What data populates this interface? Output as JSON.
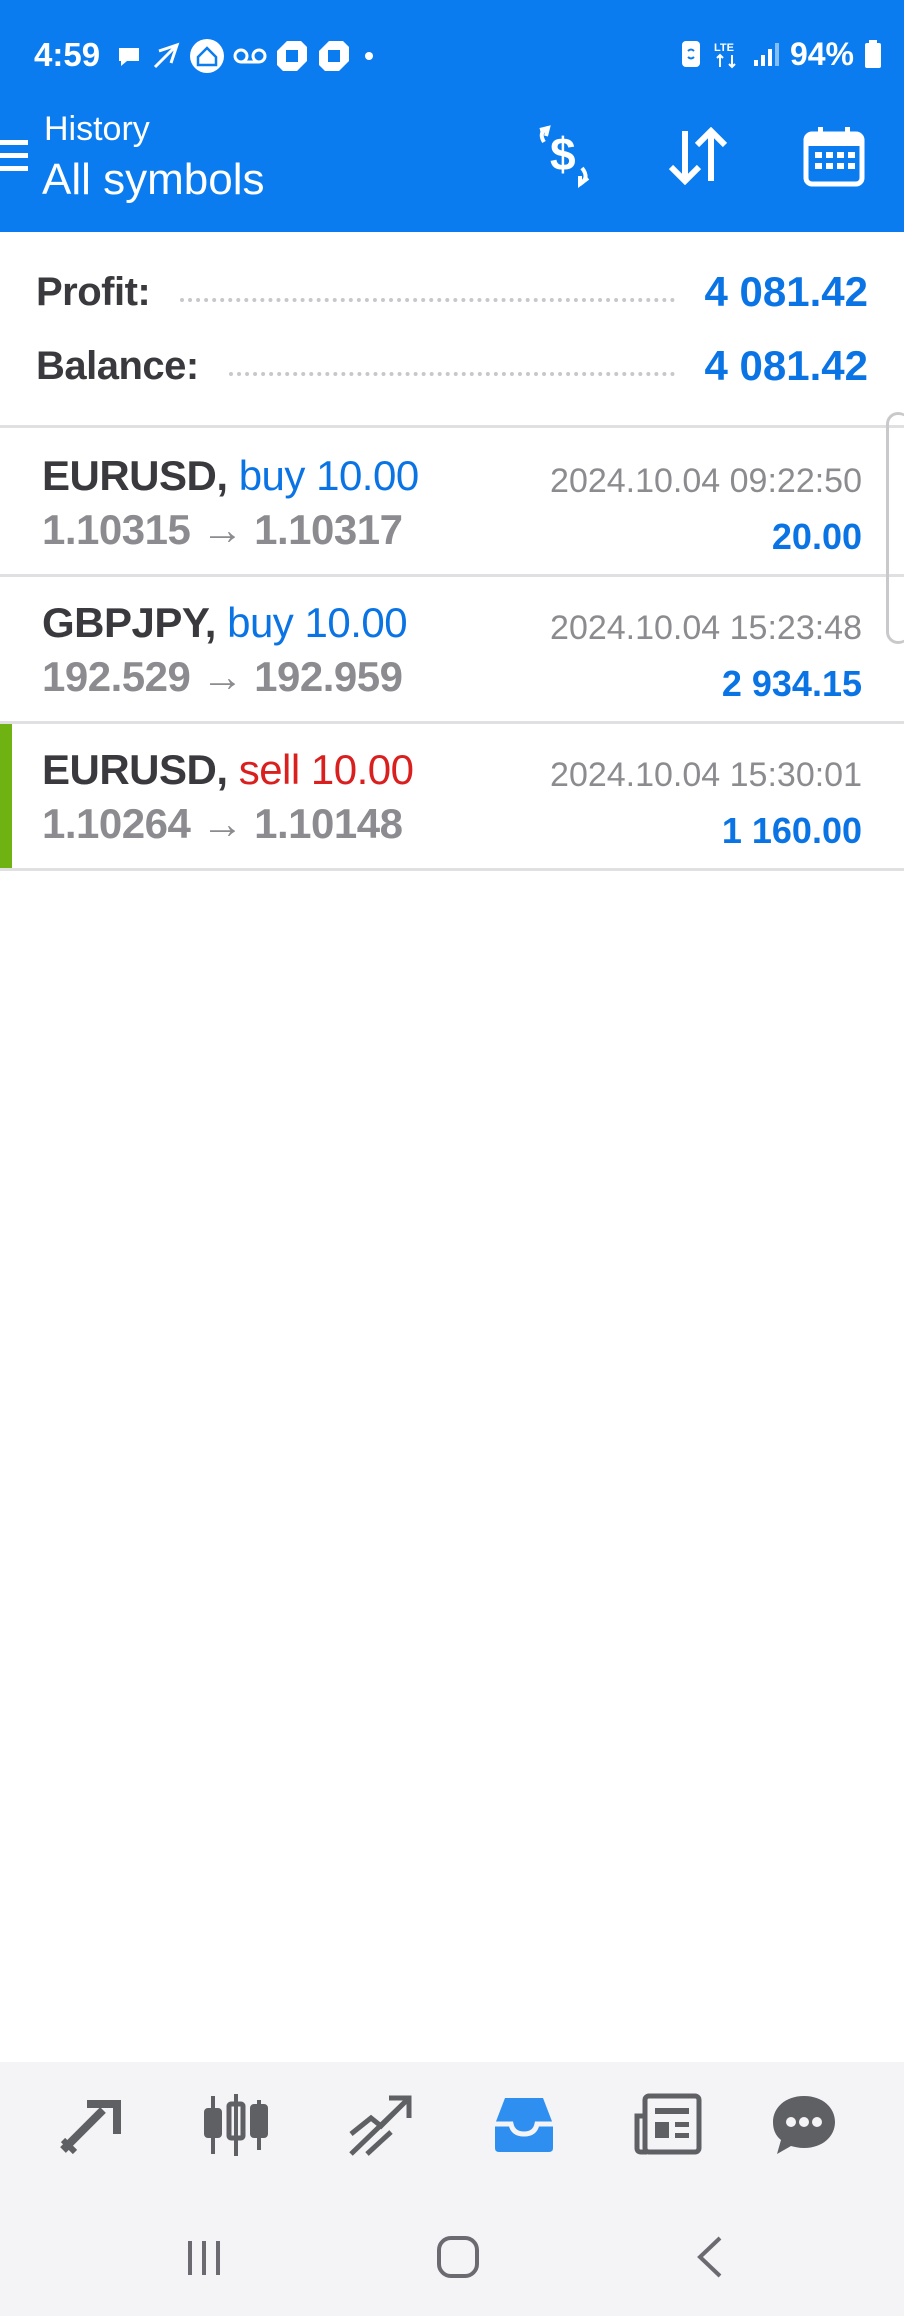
{
  "status_bar": {
    "time": "4:59",
    "battery": "94%"
  },
  "header": {
    "subtitle": "History",
    "title": "All symbols"
  },
  "summary": {
    "profit_label": "Profit:",
    "profit_value": "4 081.42",
    "balance_label": "Balance:",
    "balance_value": "4 081.42"
  },
  "deals": [
    {
      "symbol": "EURUSD,",
      "side": "buy 10.00",
      "prices": "1.10315 → 1.10317",
      "time": "2024.10.04 09:22:50",
      "profit": "20.00"
    },
    {
      "symbol": "GBPJPY,",
      "side": "buy 10.00",
      "prices": "192.529 → 192.959",
      "time": "2024.10.04 15:23:48",
      "profit": "2 934.15"
    },
    {
      "symbol": "EURUSD,",
      "side": "sell 10.00",
      "prices": "1.10264 → 1.10148",
      "time": "2024.10.04 15:30:01",
      "profit": "1 160.00"
    }
  ],
  "colors": {
    "header_blue": "#0a7cf0",
    "buy_blue": "#0b74e5",
    "sell_red": "#d9201f",
    "accent_green": "#6fb313",
    "nav_active": "#2f8ff0",
    "nav_inactive": "#5f6064"
  },
  "bottom_nav": {
    "items": [
      "quotes-icon",
      "chart-icon",
      "trade-icon",
      "history-icon",
      "news-icon",
      "messages-icon"
    ],
    "active": "history-icon"
  }
}
